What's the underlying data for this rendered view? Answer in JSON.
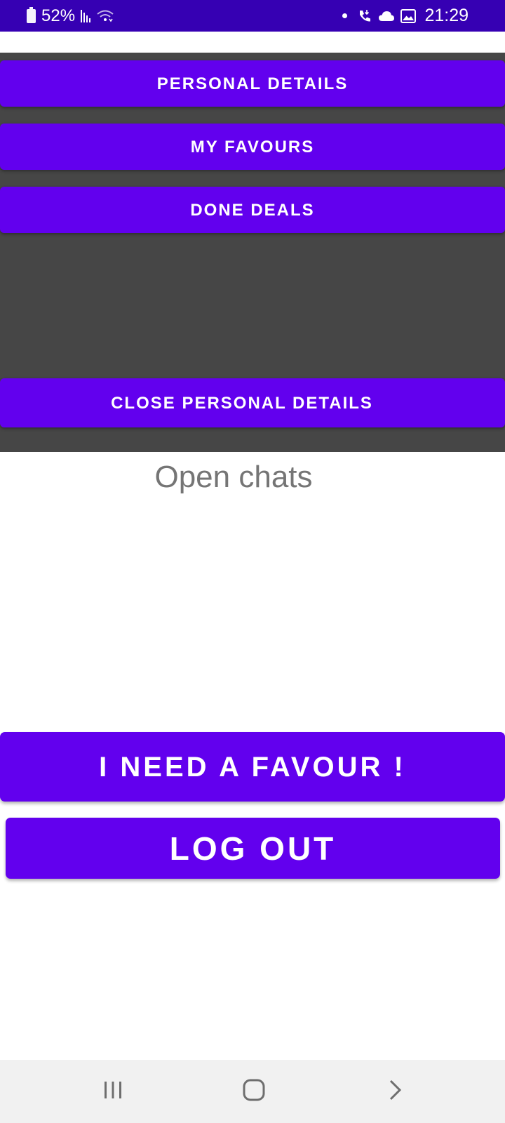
{
  "status_bar": {
    "battery_percent": "52%",
    "time": "21:29",
    "icons": [
      "battery-icon",
      "signal-icon",
      "wifi-icon",
      "dot-icon",
      "call-icon",
      "cloud-icon",
      "image-icon"
    ]
  },
  "details_menu": {
    "personal_details_label": "PERSONAL DETAILS",
    "my_favours_label": "MY FAVOURS",
    "done_deals_label": "DONE DEALS",
    "close_label": "CLOSE PERSONAL DETAILS"
  },
  "main": {
    "open_chats_title": "Open chats",
    "need_favour_label": "I NEED A FAVOUR !",
    "logout_label": "LOG OUT"
  },
  "nav_bar": {
    "icons": [
      "recents-icon",
      "home-icon",
      "back-icon"
    ]
  },
  "colors": {
    "status_bar": "#3600b3",
    "accent": "#6200ee",
    "panel": "#464646",
    "nav_bar": "#f1f1f1",
    "subtle_text": "#757575"
  }
}
